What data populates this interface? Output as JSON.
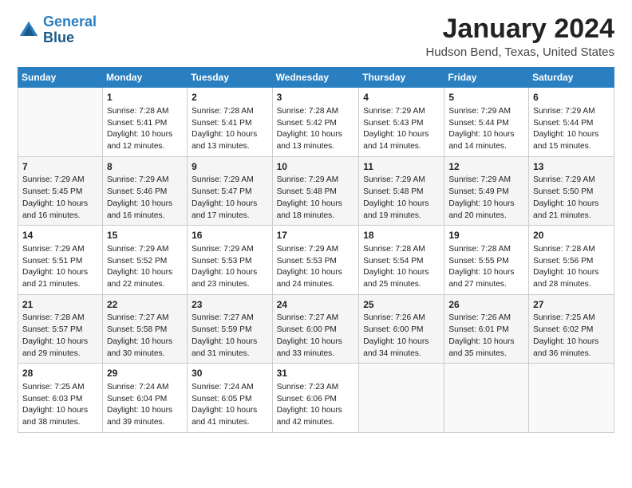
{
  "logo": {
    "line1": "General",
    "line2": "Blue"
  },
  "calendar": {
    "title": "January 2024",
    "subtitle": "Hudson Bend, Texas, United States",
    "days_of_week": [
      "Sunday",
      "Monday",
      "Tuesday",
      "Wednesday",
      "Thursday",
      "Friday",
      "Saturday"
    ],
    "weeks": [
      [
        {
          "day": "",
          "sunrise": "",
          "sunset": "",
          "daylight": ""
        },
        {
          "day": "1",
          "sunrise": "Sunrise: 7:28 AM",
          "sunset": "Sunset: 5:41 PM",
          "daylight": "Daylight: 10 hours and 12 minutes."
        },
        {
          "day": "2",
          "sunrise": "Sunrise: 7:28 AM",
          "sunset": "Sunset: 5:41 PM",
          "daylight": "Daylight: 10 hours and 13 minutes."
        },
        {
          "day": "3",
          "sunrise": "Sunrise: 7:28 AM",
          "sunset": "Sunset: 5:42 PM",
          "daylight": "Daylight: 10 hours and 13 minutes."
        },
        {
          "day": "4",
          "sunrise": "Sunrise: 7:29 AM",
          "sunset": "Sunset: 5:43 PM",
          "daylight": "Daylight: 10 hours and 14 minutes."
        },
        {
          "day": "5",
          "sunrise": "Sunrise: 7:29 AM",
          "sunset": "Sunset: 5:44 PM",
          "daylight": "Daylight: 10 hours and 14 minutes."
        },
        {
          "day": "6",
          "sunrise": "Sunrise: 7:29 AM",
          "sunset": "Sunset: 5:44 PM",
          "daylight": "Daylight: 10 hours and 15 minutes."
        }
      ],
      [
        {
          "day": "7",
          "sunrise": "Sunrise: 7:29 AM",
          "sunset": "Sunset: 5:45 PM",
          "daylight": "Daylight: 10 hours and 16 minutes."
        },
        {
          "day": "8",
          "sunrise": "Sunrise: 7:29 AM",
          "sunset": "Sunset: 5:46 PM",
          "daylight": "Daylight: 10 hours and 16 minutes."
        },
        {
          "day": "9",
          "sunrise": "Sunrise: 7:29 AM",
          "sunset": "Sunset: 5:47 PM",
          "daylight": "Daylight: 10 hours and 17 minutes."
        },
        {
          "day": "10",
          "sunrise": "Sunrise: 7:29 AM",
          "sunset": "Sunset: 5:48 PM",
          "daylight": "Daylight: 10 hours and 18 minutes."
        },
        {
          "day": "11",
          "sunrise": "Sunrise: 7:29 AM",
          "sunset": "Sunset: 5:48 PM",
          "daylight": "Daylight: 10 hours and 19 minutes."
        },
        {
          "day": "12",
          "sunrise": "Sunrise: 7:29 AM",
          "sunset": "Sunset: 5:49 PM",
          "daylight": "Daylight: 10 hours and 20 minutes."
        },
        {
          "day": "13",
          "sunrise": "Sunrise: 7:29 AM",
          "sunset": "Sunset: 5:50 PM",
          "daylight": "Daylight: 10 hours and 21 minutes."
        }
      ],
      [
        {
          "day": "14",
          "sunrise": "Sunrise: 7:29 AM",
          "sunset": "Sunset: 5:51 PM",
          "daylight": "Daylight: 10 hours and 21 minutes."
        },
        {
          "day": "15",
          "sunrise": "Sunrise: 7:29 AM",
          "sunset": "Sunset: 5:52 PM",
          "daylight": "Daylight: 10 hours and 22 minutes."
        },
        {
          "day": "16",
          "sunrise": "Sunrise: 7:29 AM",
          "sunset": "Sunset: 5:53 PM",
          "daylight": "Daylight: 10 hours and 23 minutes."
        },
        {
          "day": "17",
          "sunrise": "Sunrise: 7:29 AM",
          "sunset": "Sunset: 5:53 PM",
          "daylight": "Daylight: 10 hours and 24 minutes."
        },
        {
          "day": "18",
          "sunrise": "Sunrise: 7:28 AM",
          "sunset": "Sunset: 5:54 PM",
          "daylight": "Daylight: 10 hours and 25 minutes."
        },
        {
          "day": "19",
          "sunrise": "Sunrise: 7:28 AM",
          "sunset": "Sunset: 5:55 PM",
          "daylight": "Daylight: 10 hours and 27 minutes."
        },
        {
          "day": "20",
          "sunrise": "Sunrise: 7:28 AM",
          "sunset": "Sunset: 5:56 PM",
          "daylight": "Daylight: 10 hours and 28 minutes."
        }
      ],
      [
        {
          "day": "21",
          "sunrise": "Sunrise: 7:28 AM",
          "sunset": "Sunset: 5:57 PM",
          "daylight": "Daylight: 10 hours and 29 minutes."
        },
        {
          "day": "22",
          "sunrise": "Sunrise: 7:27 AM",
          "sunset": "Sunset: 5:58 PM",
          "daylight": "Daylight: 10 hours and 30 minutes."
        },
        {
          "day": "23",
          "sunrise": "Sunrise: 7:27 AM",
          "sunset": "Sunset: 5:59 PM",
          "daylight": "Daylight: 10 hours and 31 minutes."
        },
        {
          "day": "24",
          "sunrise": "Sunrise: 7:27 AM",
          "sunset": "Sunset: 6:00 PM",
          "daylight": "Daylight: 10 hours and 33 minutes."
        },
        {
          "day": "25",
          "sunrise": "Sunrise: 7:26 AM",
          "sunset": "Sunset: 6:00 PM",
          "daylight": "Daylight: 10 hours and 34 minutes."
        },
        {
          "day": "26",
          "sunrise": "Sunrise: 7:26 AM",
          "sunset": "Sunset: 6:01 PM",
          "daylight": "Daylight: 10 hours and 35 minutes."
        },
        {
          "day": "27",
          "sunrise": "Sunrise: 7:25 AM",
          "sunset": "Sunset: 6:02 PM",
          "daylight": "Daylight: 10 hours and 36 minutes."
        }
      ],
      [
        {
          "day": "28",
          "sunrise": "Sunrise: 7:25 AM",
          "sunset": "Sunset: 6:03 PM",
          "daylight": "Daylight: 10 hours and 38 minutes."
        },
        {
          "day": "29",
          "sunrise": "Sunrise: 7:24 AM",
          "sunset": "Sunset: 6:04 PM",
          "daylight": "Daylight: 10 hours and 39 minutes."
        },
        {
          "day": "30",
          "sunrise": "Sunrise: 7:24 AM",
          "sunset": "Sunset: 6:05 PM",
          "daylight": "Daylight: 10 hours and 41 minutes."
        },
        {
          "day": "31",
          "sunrise": "Sunrise: 7:23 AM",
          "sunset": "Sunset: 6:06 PM",
          "daylight": "Daylight: 10 hours and 42 minutes."
        },
        {
          "day": "",
          "sunrise": "",
          "sunset": "",
          "daylight": ""
        },
        {
          "day": "",
          "sunrise": "",
          "sunset": "",
          "daylight": ""
        },
        {
          "day": "",
          "sunrise": "",
          "sunset": "",
          "daylight": ""
        }
      ]
    ]
  }
}
